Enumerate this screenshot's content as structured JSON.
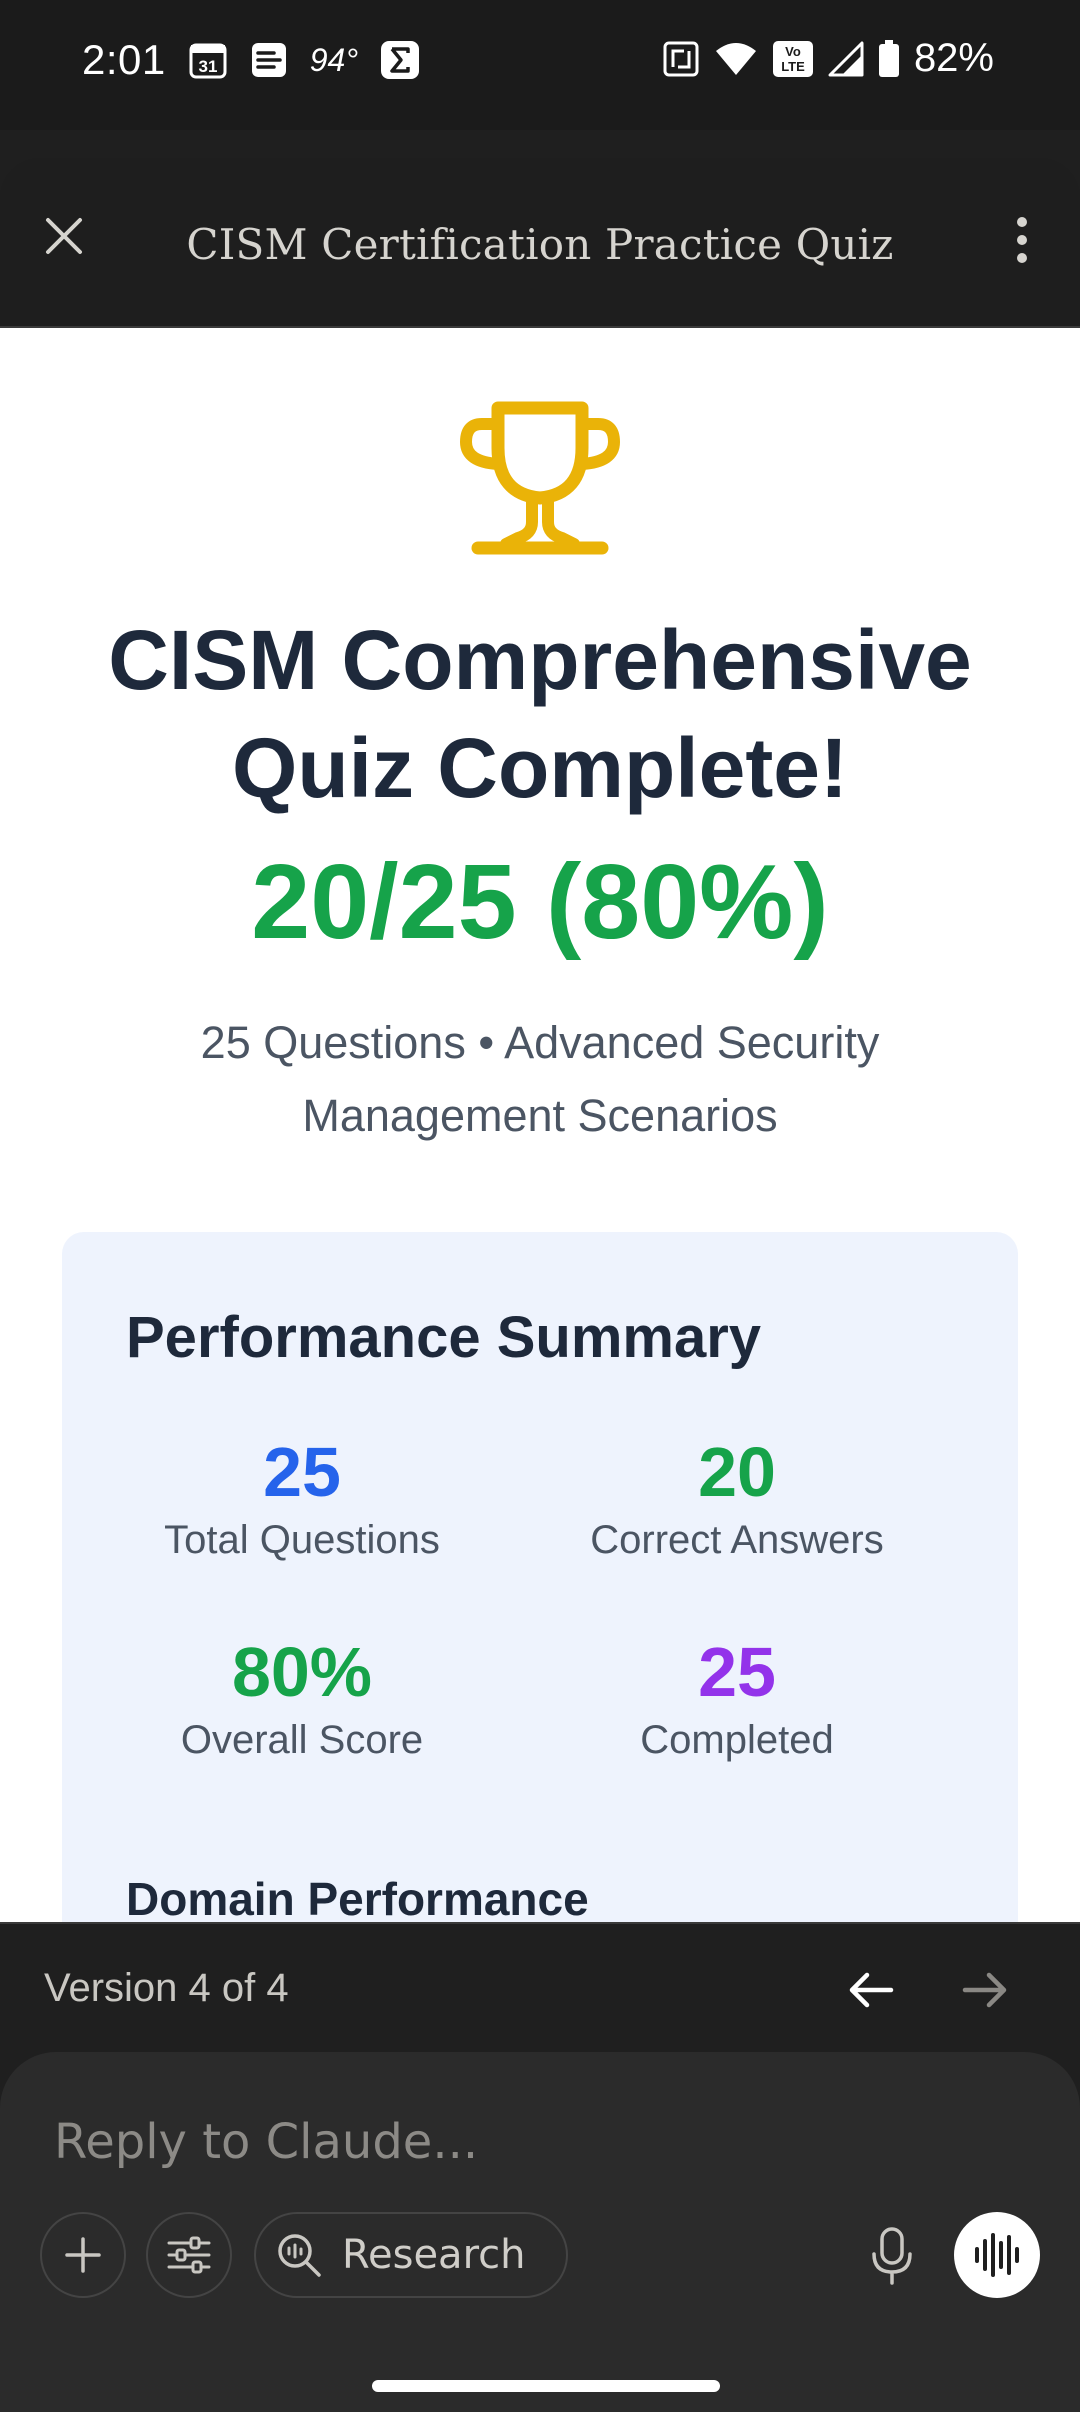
{
  "status_bar": {
    "time": "2:01",
    "calendar_day": "31",
    "temperature": "94°",
    "battery": "82%",
    "volte": "Vo LTE"
  },
  "header": {
    "title": "CISM Certification Practice Quiz"
  },
  "quiz": {
    "title": "CISM Comprehensive Quiz Complete!",
    "score": "20/25 (80%)",
    "subtitle": "25 Questions • Advanced Security Management Scenarios"
  },
  "summary": {
    "title": "Performance Summary",
    "stats": [
      {
        "value": "25",
        "label": "Total Questions",
        "color": "#2563eb"
      },
      {
        "value": "20",
        "label": "Correct Answers",
        "color": "#16a34a"
      },
      {
        "value": "80%",
        "label": "Overall Score",
        "color": "#16a34a"
      },
      {
        "value": "25",
        "label": "Completed",
        "color": "#9333ea"
      }
    ],
    "domain_title": "Domain Performance"
  },
  "version_bar": {
    "text": "Version 4 of 4"
  },
  "composer": {
    "placeholder": "Reply to Claude...",
    "research_label": "Research"
  },
  "colors": {
    "trophy": "#eab308",
    "score_green": "#16a34a"
  }
}
